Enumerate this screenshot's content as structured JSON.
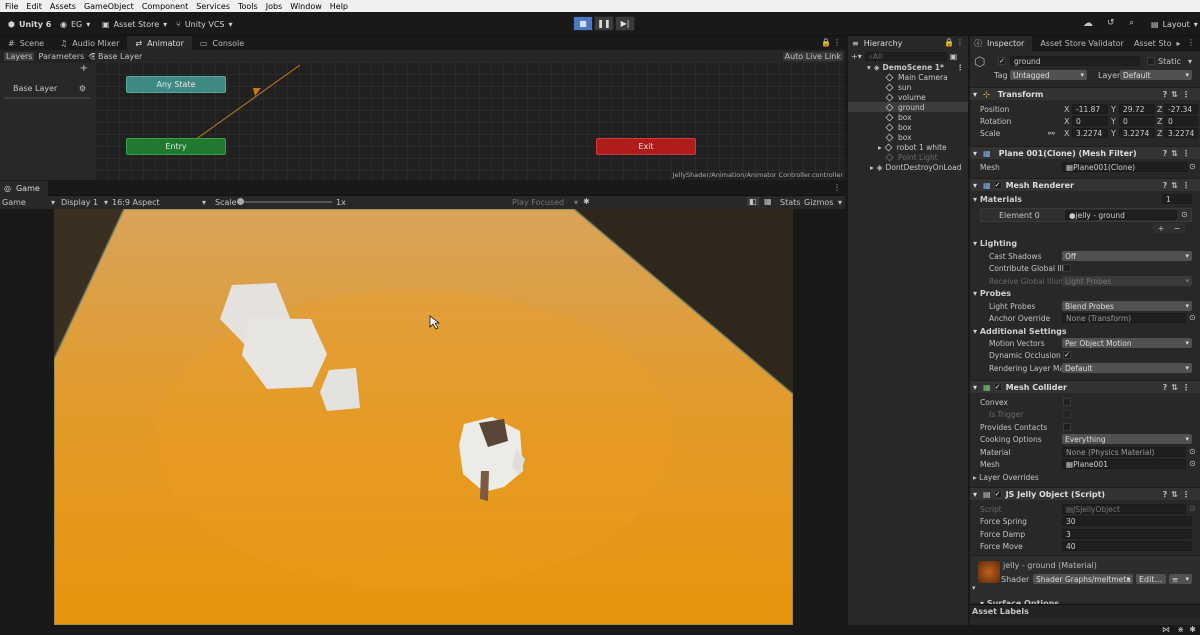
{
  "menubar": {
    "items": [
      "File",
      "Edit",
      "Assets",
      "GameObject",
      "Component",
      "Services",
      "Tools",
      "Jobs",
      "Window",
      "Help"
    ]
  },
  "toolbar": {
    "unity_label": "Unity 6",
    "account_label": "EG",
    "asset_store_label": "Asset Store",
    "vcs_label": "Unity VCS",
    "layout_label": "Layout"
  },
  "top_tabs": {
    "scene": "Scene",
    "audio_mixer": "Audio Mixer",
    "animator": "Animator",
    "console": "Console"
  },
  "animator": {
    "layers_tab": "Layers",
    "parameters_tab": "Parameters",
    "breadcrumb": "Base Layer",
    "auto_live_link": "Auto Live Link",
    "layer_name": "Base Layer",
    "node_any_state": "Any State",
    "node_entry": "Entry",
    "node_exit": "Exit",
    "footer_path": "JellyShader/Animation/Animator Controller.controller"
  },
  "game": {
    "tab_label": "Game",
    "mode_dropdown": "Game",
    "display_dropdown": "Display 1",
    "aspect_dropdown": "16:9 Aspect",
    "scale_label": "Scale",
    "scale_value": "1x",
    "play_focused": "Play Focused",
    "stats_label": "Stats",
    "gizmos_label": "Gizmos"
  },
  "hierarchy": {
    "tab_label": "Hierarchy",
    "search_placeholder": "All",
    "items": [
      {
        "label": "DemoScene 1*"
      },
      {
        "label": "Main Camera"
      },
      {
        "label": "sun"
      },
      {
        "label": "volume"
      },
      {
        "label": "ground"
      },
      {
        "label": "box"
      },
      {
        "label": "box"
      },
      {
        "label": "box"
      },
      {
        "label": "robot 1 white"
      },
      {
        "label": "Point Light"
      },
      {
        "label": "DontDestroyOnLoad"
      }
    ]
  },
  "inspector": {
    "tabs": [
      "Inspector",
      "Asset Store Validator",
      "Asset Sto"
    ],
    "object_name": "ground",
    "static_label": "Static",
    "tag_label": "Tag",
    "tag_value": "Untagged",
    "layer_label": "Layer",
    "layer_value": "Default",
    "transform": {
      "title": "Transform",
      "position_label": "Position",
      "rotation_label": "Rotation",
      "scale_label": "Scale",
      "position": {
        "x": "-11.87",
        "y": "29.72",
        "z": "-27.34"
      },
      "rotation": {
        "x": "0",
        "y": "0",
        "z": "0"
      },
      "scale": {
        "x": "3.2274",
        "y": "3.2274",
        "z": "3.2274"
      }
    },
    "mesh_filter": {
      "title": "Plane 001(Clone) (Mesh Filter)",
      "mesh_label": "Mesh",
      "mesh_value": "Plane001(Clone)"
    },
    "mesh_renderer": {
      "title": "Mesh Renderer",
      "materials_label": "Materials",
      "materials_count": "1",
      "element0_label": "Element 0",
      "element0_value": "jelly - ground",
      "lighting_label": "Lighting",
      "cast_shadows_label": "Cast Shadows",
      "cast_shadows_value": "Off",
      "contribute_gi_label": "Contribute Global Illu",
      "receive_gi_label": "Receive Global Illum",
      "receive_gi_value": "Light Probes",
      "probes_label": "Probes",
      "light_probes_label": "Light Probes",
      "light_probes_value": "Blend Probes",
      "anchor_override_label": "Anchor Override",
      "anchor_override_value": "None (Transform)",
      "additional_label": "Additional Settings",
      "motion_vectors_label": "Motion Vectors",
      "motion_vectors_value": "Per Object Motion",
      "dynamic_occlusion_label": "Dynamic Occlusion",
      "rendering_layer_label": "Rendering Layer Ma",
      "rendering_layer_value": "Default"
    },
    "mesh_collider": {
      "title": "Mesh Collider",
      "convex_label": "Convex",
      "is_trigger_label": "Is Trigger",
      "provides_contacts_label": "Provides Contacts",
      "cooking_options_label": "Cooking Options",
      "cooking_options_value": "Everything",
      "material_label": "Material",
      "material_value": "None (Physics Material)",
      "mesh_label": "Mesh",
      "mesh_value": "Plane001",
      "layer_overrides_label": "Layer Overrides"
    },
    "jelly_script": {
      "title": "JS Jelly Object (Script)",
      "script_label": "Script",
      "script_value": "JSJellyObject",
      "force_spring_label": "Force Spring",
      "force_spring_value": "30",
      "force_damp_label": "Force Damp",
      "force_damp_value": "3",
      "force_move_label": "Force Move",
      "force_move_value": "40"
    },
    "material": {
      "title": "jelly - ground (Material)",
      "shader_label": "Shader",
      "shader_value": "Shader Graphs/meltmeta",
      "edit_label": "Edit...",
      "surface_options_label": "Surface Options"
    },
    "asset_labels": "Asset Labels"
  },
  "colors": {
    "accent": "#4a78c4",
    "any_state": "#3e8a83",
    "entry": "#1f7a30",
    "exit": "#b01c1c"
  }
}
